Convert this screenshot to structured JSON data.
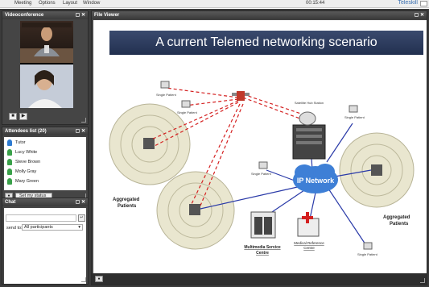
{
  "menubar": {
    "items": [
      "Meeting",
      "Options",
      "Layout",
      "Window"
    ],
    "time": "00:15:44",
    "brand": "Teleskill"
  },
  "videoconference": {
    "title": "Videoconference",
    "window_buttons": "▢ ✕"
  },
  "attendees": {
    "title": "Attendees list (20)",
    "window_buttons": "▢ ✕",
    "people": [
      {
        "name": "Tutor",
        "color": "#2e7bd1"
      },
      {
        "name": "Lucy White",
        "color": "#3aa14a"
      },
      {
        "name": "Steve Brown",
        "color": "#3aa14a"
      },
      {
        "name": "Molly Gray",
        "color": "#3aa14a"
      },
      {
        "name": "Mary Green",
        "color": "#3aa14a"
      }
    ],
    "status_button": "Set my status"
  },
  "chat": {
    "title": "Chat",
    "window_buttons": "▢ ✕",
    "send_to_label": "send to:",
    "send_to_value": "All participants"
  },
  "file_viewer": {
    "title": "File Viewer",
    "window_buttons": "▢ ✕",
    "slide": {
      "title": "A current Telemed networking scenario",
      "labels": {
        "single_patient": "Single Patient",
        "satellite": "Satellite Hub Station",
        "ip_network": "IP Network",
        "aggregated": "Aggregated",
        "patients": "Patients",
        "multimedia": "Multimedia Service",
        "centre": "Centre",
        "medical": "Medical Reference",
        "medical_centre": "Centre"
      }
    }
  },
  "colors": {
    "panel_bg": "#454545",
    "slide_title_bg": "#2b3a5c",
    "link_red": "#d42020",
    "link_blue": "#2a3aa8",
    "cloud_blue": "#3e7fd6",
    "cell_fill": "#e9e6cf"
  }
}
